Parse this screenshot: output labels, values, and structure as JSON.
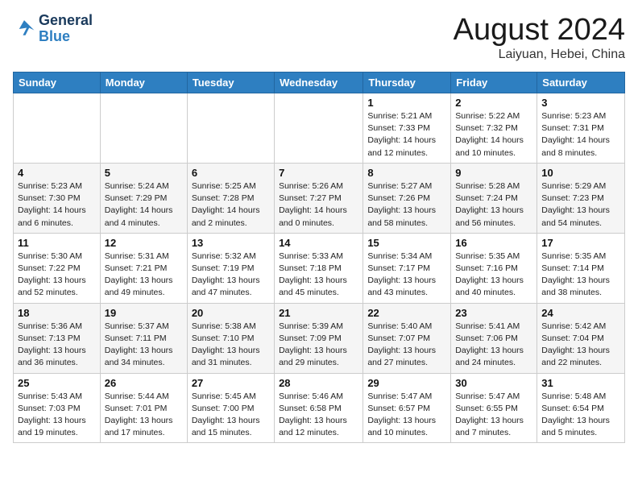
{
  "header": {
    "logo_line1": "General",
    "logo_line2": "Blue",
    "month": "August 2024",
    "location": "Laiyuan, Hebei, China"
  },
  "weekdays": [
    "Sunday",
    "Monday",
    "Tuesday",
    "Wednesday",
    "Thursday",
    "Friday",
    "Saturday"
  ],
  "weeks": [
    [
      {
        "day": "",
        "info": ""
      },
      {
        "day": "",
        "info": ""
      },
      {
        "day": "",
        "info": ""
      },
      {
        "day": "",
        "info": ""
      },
      {
        "day": "1",
        "info": "Sunrise: 5:21 AM\nSunset: 7:33 PM\nDaylight: 14 hours\nand 12 minutes."
      },
      {
        "day": "2",
        "info": "Sunrise: 5:22 AM\nSunset: 7:32 PM\nDaylight: 14 hours\nand 10 minutes."
      },
      {
        "day": "3",
        "info": "Sunrise: 5:23 AM\nSunset: 7:31 PM\nDaylight: 14 hours\nand 8 minutes."
      }
    ],
    [
      {
        "day": "4",
        "info": "Sunrise: 5:23 AM\nSunset: 7:30 PM\nDaylight: 14 hours\nand 6 minutes."
      },
      {
        "day": "5",
        "info": "Sunrise: 5:24 AM\nSunset: 7:29 PM\nDaylight: 14 hours\nand 4 minutes."
      },
      {
        "day": "6",
        "info": "Sunrise: 5:25 AM\nSunset: 7:28 PM\nDaylight: 14 hours\nand 2 minutes."
      },
      {
        "day": "7",
        "info": "Sunrise: 5:26 AM\nSunset: 7:27 PM\nDaylight: 14 hours\nand 0 minutes."
      },
      {
        "day": "8",
        "info": "Sunrise: 5:27 AM\nSunset: 7:26 PM\nDaylight: 13 hours\nand 58 minutes."
      },
      {
        "day": "9",
        "info": "Sunrise: 5:28 AM\nSunset: 7:24 PM\nDaylight: 13 hours\nand 56 minutes."
      },
      {
        "day": "10",
        "info": "Sunrise: 5:29 AM\nSunset: 7:23 PM\nDaylight: 13 hours\nand 54 minutes."
      }
    ],
    [
      {
        "day": "11",
        "info": "Sunrise: 5:30 AM\nSunset: 7:22 PM\nDaylight: 13 hours\nand 52 minutes."
      },
      {
        "day": "12",
        "info": "Sunrise: 5:31 AM\nSunset: 7:21 PM\nDaylight: 13 hours\nand 49 minutes."
      },
      {
        "day": "13",
        "info": "Sunrise: 5:32 AM\nSunset: 7:19 PM\nDaylight: 13 hours\nand 47 minutes."
      },
      {
        "day": "14",
        "info": "Sunrise: 5:33 AM\nSunset: 7:18 PM\nDaylight: 13 hours\nand 45 minutes."
      },
      {
        "day": "15",
        "info": "Sunrise: 5:34 AM\nSunset: 7:17 PM\nDaylight: 13 hours\nand 43 minutes."
      },
      {
        "day": "16",
        "info": "Sunrise: 5:35 AM\nSunset: 7:16 PM\nDaylight: 13 hours\nand 40 minutes."
      },
      {
        "day": "17",
        "info": "Sunrise: 5:35 AM\nSunset: 7:14 PM\nDaylight: 13 hours\nand 38 minutes."
      }
    ],
    [
      {
        "day": "18",
        "info": "Sunrise: 5:36 AM\nSunset: 7:13 PM\nDaylight: 13 hours\nand 36 minutes."
      },
      {
        "day": "19",
        "info": "Sunrise: 5:37 AM\nSunset: 7:11 PM\nDaylight: 13 hours\nand 34 minutes."
      },
      {
        "day": "20",
        "info": "Sunrise: 5:38 AM\nSunset: 7:10 PM\nDaylight: 13 hours\nand 31 minutes."
      },
      {
        "day": "21",
        "info": "Sunrise: 5:39 AM\nSunset: 7:09 PM\nDaylight: 13 hours\nand 29 minutes."
      },
      {
        "day": "22",
        "info": "Sunrise: 5:40 AM\nSunset: 7:07 PM\nDaylight: 13 hours\nand 27 minutes."
      },
      {
        "day": "23",
        "info": "Sunrise: 5:41 AM\nSunset: 7:06 PM\nDaylight: 13 hours\nand 24 minutes."
      },
      {
        "day": "24",
        "info": "Sunrise: 5:42 AM\nSunset: 7:04 PM\nDaylight: 13 hours\nand 22 minutes."
      }
    ],
    [
      {
        "day": "25",
        "info": "Sunrise: 5:43 AM\nSunset: 7:03 PM\nDaylight: 13 hours\nand 19 minutes."
      },
      {
        "day": "26",
        "info": "Sunrise: 5:44 AM\nSunset: 7:01 PM\nDaylight: 13 hours\nand 17 minutes."
      },
      {
        "day": "27",
        "info": "Sunrise: 5:45 AM\nSunset: 7:00 PM\nDaylight: 13 hours\nand 15 minutes."
      },
      {
        "day": "28",
        "info": "Sunrise: 5:46 AM\nSunset: 6:58 PM\nDaylight: 13 hours\nand 12 minutes."
      },
      {
        "day": "29",
        "info": "Sunrise: 5:47 AM\nSunset: 6:57 PM\nDaylight: 13 hours\nand 10 minutes."
      },
      {
        "day": "30",
        "info": "Sunrise: 5:47 AM\nSunset: 6:55 PM\nDaylight: 13 hours\nand 7 minutes."
      },
      {
        "day": "31",
        "info": "Sunrise: 5:48 AM\nSunset: 6:54 PM\nDaylight: 13 hours\nand 5 minutes."
      }
    ]
  ]
}
